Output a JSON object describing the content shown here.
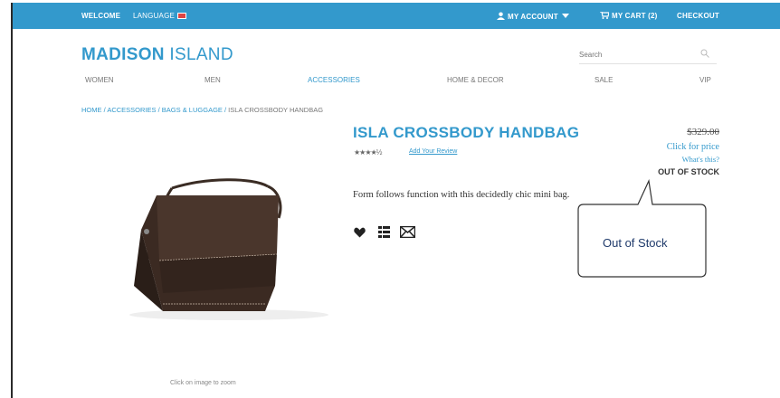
{
  "header": {
    "welcome": "WELCOME",
    "language": "LANGUAGE",
    "my_account": "MY ACCOUNT",
    "my_cart": "MY CART (2)",
    "checkout": "CHECKOUT",
    "bar_color": "#3399cc"
  },
  "logo": {
    "bold": "MADISON",
    "light": " ISLAND"
  },
  "search": {
    "placeholder": "Search"
  },
  "nav": {
    "items": [
      "WOMEN",
      "MEN",
      "ACCESSORIES",
      "HOME & DECOR",
      "SALE",
      "VIP"
    ],
    "active": "ACCESSORIES"
  },
  "breadcrumb": {
    "home": "HOME",
    "accessories": "ACCESSORIES",
    "bags": "BAGS & LUGGAGE",
    "current": "ISLA CROSSBODY HANDBAG",
    "separator": " / "
  },
  "product": {
    "title": "ISLA CROSSBODY HANDBAG",
    "rating_stars": "★★★★½",
    "review_link": "Add Your Review",
    "description": "Form follows function with this decidedly chic mini bag.",
    "old_price": "$329.00",
    "click_for_price": "Click for price",
    "whats_that": "What's this?",
    "stock_status": "OUT OF STOCK",
    "zoom_caption": "Click on image to zoom"
  },
  "callout": {
    "label": "Out of Stock"
  },
  "icons": [
    "user-icon",
    "cart-icon",
    "search-icon",
    "heart-icon",
    "compare-icon",
    "email-icon"
  ],
  "colors": {
    "accent": "#3399cc",
    "text": "#333333",
    "callout_text": "#1f3a6b"
  }
}
